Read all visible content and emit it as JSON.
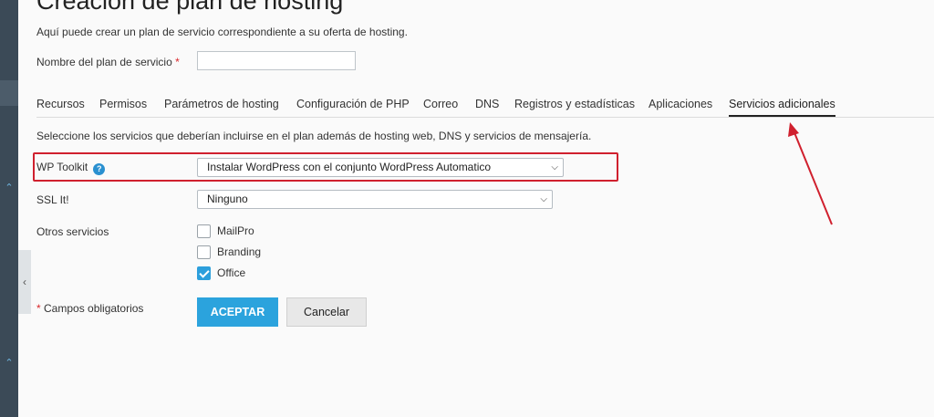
{
  "page": {
    "title": "Creación de plan de hosting",
    "intro": "Aquí puede crear un plan de servicio correspondiente a su oferta de hosting."
  },
  "form": {
    "plan_name_label": "Nombre del plan de servicio",
    "required_mark": "*",
    "plan_name_value": ""
  },
  "tabs": [
    {
      "label": "Recursos"
    },
    {
      "label": "Permisos"
    },
    {
      "label": "Parámetros de hosting"
    },
    {
      "label": "Configuración de PHP"
    },
    {
      "label": "Correo"
    },
    {
      "label": "DNS"
    },
    {
      "label": "Registros y estadísticas"
    },
    {
      "label": "Aplicaciones"
    },
    {
      "label": "Servicios adicionales",
      "active": true
    }
  ],
  "section": {
    "description": "Seleccione los servicios que deberían incluirse en el plan además de hosting web, DNS y servicios de mensajería.",
    "wp_toolkit": {
      "label": "WP Toolkit",
      "help_glyph": "?",
      "value": "Instalar WordPress con el conjunto WordPress Automatico"
    },
    "ssl_it": {
      "label": "SSL It!",
      "value": "Ninguno"
    },
    "other_services": {
      "label": "Otros servicios",
      "items": [
        {
          "label": "MailPro",
          "checked": false
        },
        {
          "label": "Branding",
          "checked": false
        },
        {
          "label": "Office",
          "checked": true
        }
      ]
    }
  },
  "footer": {
    "required_note": "Campos obligatorios",
    "accept_label": "ACEPTAR",
    "cancel_label": "Cancelar"
  },
  "colors": {
    "accent": "#2ba3dd",
    "highlight": "#d0202e",
    "sidebar": "#3b4a57"
  }
}
